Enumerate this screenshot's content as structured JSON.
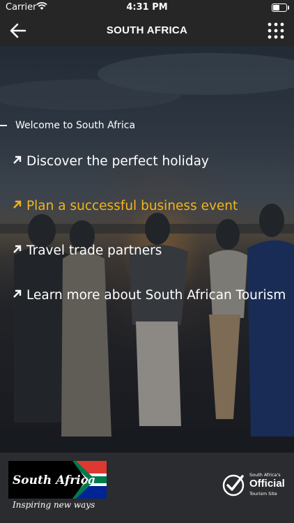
{
  "status_bar": {
    "carrier": "Carrier",
    "time": "4:31 PM",
    "battery_level": 0.55
  },
  "nav": {
    "title": "SOUTH AFRICA",
    "back_icon": "arrow-left-icon",
    "menu_icon": "grid-dots-icon"
  },
  "menu": {
    "welcome": "Welcome to South Africa",
    "items": [
      {
        "label": "Discover the perfect holiday",
        "active": false
      },
      {
        "label": "Plan a successful business event",
        "active": true
      },
      {
        "label": "Travel trade partners",
        "active": false
      },
      {
        "label": "Learn more about South African Tourism",
        "active": false
      }
    ]
  },
  "colors": {
    "accent": "#f2b519",
    "bar_bg": "#262626",
    "footer_bg": "#2a2c2f"
  },
  "footer": {
    "logo_text": "South Africa",
    "tagline": "Inspiring new ways",
    "badge_line1": "South Africa's",
    "badge_main": "Official",
    "badge_line2": "Tourism Site"
  }
}
